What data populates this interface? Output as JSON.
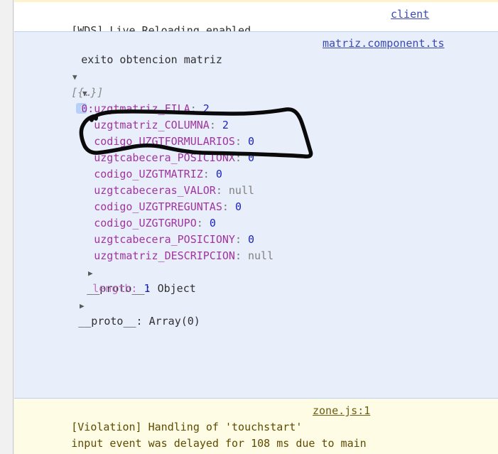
{
  "console": {
    "messages": [
      {
        "kind": "log",
        "text": "[WDS] Live Reloading enabled.",
        "source_link": "client"
      },
      {
        "kind": "info",
        "text": "exito obtencion matriz",
        "source_link": "matriz.component.ts",
        "object": {
          "preview": "[{…}]",
          "badge": "i",
          "index_label": "0:",
          "properties": [
            {
              "name": "uzgtmatriz_FILA",
              "value": "2",
              "value_type": "number"
            },
            {
              "name": "uzgtmatriz_COLUMNA",
              "value": "2",
              "value_type": "number"
            },
            {
              "name": "codigo_UZGTFORMULARIOS",
              "value": "0",
              "value_type": "number"
            },
            {
              "name": "uzgtcabecera_POSICIONX",
              "value": "0",
              "value_type": "number"
            },
            {
              "name": "codigo_UZGTMATRIZ",
              "value": "0",
              "value_type": "number"
            },
            {
              "name": "uzgtcabeceras_VALOR",
              "value": "null",
              "value_type": "null"
            },
            {
              "name": "codigo_UZGTPREGUNTAS",
              "value": "0",
              "value_type": "number"
            },
            {
              "name": "codigo_UZGTGRUPO",
              "value": "0",
              "value_type": "number"
            },
            {
              "name": "uzgtcabecera_POSICIONY",
              "value": "0",
              "value_type": "number"
            },
            {
              "name": "uzgtmatriz_DESCRIPCION",
              "value": "null",
              "value_type": "null"
            }
          ],
          "proto_object": "__proto__: Object",
          "length_key": "length:",
          "length_value": "1",
          "proto_array": "__proto__: Array(0)"
        }
      },
      {
        "kind": "violation",
        "line1": "[Violation] Handling of 'touchstart'",
        "line2": "input event was delayed for 108 ms due to main",
        "source_link": "zone.js:1"
      }
    ]
  },
  "annotation": {
    "type": "hand-drawn-circle",
    "color": "#000000",
    "encircles": "uzgtmatriz_COLUMNA: 2"
  },
  "colors": {
    "log_background": "#ffffff",
    "info_background": "#e8eefa",
    "info_border": "#bcd1ef",
    "violation_background": "#fffce5",
    "gutter": "#f1f1f1",
    "property_name": "#a034a0",
    "number_value": "#1c24c4",
    "null_value": "#808080",
    "link": "#3b4ab0",
    "badge": "#b6d0f7"
  }
}
